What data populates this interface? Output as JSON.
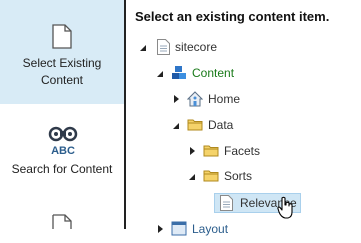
{
  "sidebar": {
    "items": [
      {
        "label_line1": "Select Existing",
        "label_line2": "Content",
        "icon": "document-icon",
        "selected": true
      },
      {
        "label_line1": "Search for Content",
        "icon": "binoculars-icon",
        "icon_text": "ABC"
      },
      {
        "label_line1": "",
        "icon": "document-icon"
      }
    ]
  },
  "main": {
    "title": "Select an existing content item.",
    "tree": [
      {
        "label": "sitecore",
        "level": 0,
        "expanded": true,
        "icon": "page-icon"
      },
      {
        "label": "Content",
        "level": 1,
        "expanded": true,
        "icon": "content-cubes-icon",
        "color": "#1a7a1a"
      },
      {
        "label": "Home",
        "level": 2,
        "expanded": false,
        "icon": "home-icon"
      },
      {
        "label": "Data",
        "level": 2,
        "expanded": true,
        "icon": "folder-icon"
      },
      {
        "label": "Facets",
        "level": 3,
        "expanded": false,
        "icon": "folder-icon"
      },
      {
        "label": "Sorts",
        "level": 3,
        "expanded": true,
        "icon": "folder-icon"
      },
      {
        "label": "Relevance",
        "level": 4,
        "icon": "page-icon",
        "selected": true
      },
      {
        "label": "Layout",
        "level": 1,
        "expanded": false,
        "icon": "layout-icon"
      }
    ]
  },
  "colors": {
    "sidebar_selected": "#d8ebf6",
    "tree_selected": "#cfe6f5",
    "content_green": "#1a7a1a"
  }
}
